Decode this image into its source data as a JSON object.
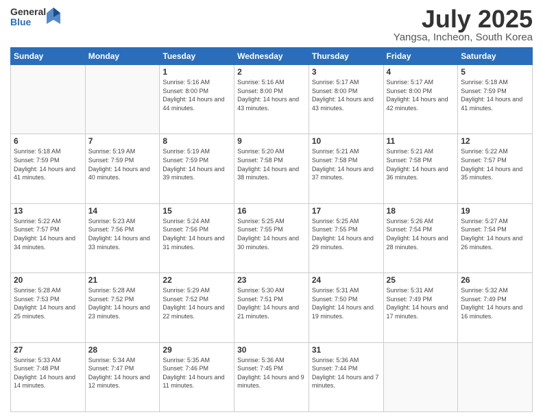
{
  "header": {
    "logo_general": "General",
    "logo_blue": "Blue",
    "title": "July 2025",
    "location": "Yangsa, Incheon, South Korea"
  },
  "calendar": {
    "weekdays": [
      "Sunday",
      "Monday",
      "Tuesday",
      "Wednesday",
      "Thursday",
      "Friday",
      "Saturday"
    ],
    "weeks": [
      [
        {
          "day": "",
          "sunrise": "",
          "sunset": "",
          "daylight": ""
        },
        {
          "day": "",
          "sunrise": "",
          "sunset": "",
          "daylight": ""
        },
        {
          "day": "1",
          "sunrise": "Sunrise: 5:16 AM",
          "sunset": "Sunset: 8:00 PM",
          "daylight": "Daylight: 14 hours and 44 minutes."
        },
        {
          "day": "2",
          "sunrise": "Sunrise: 5:16 AM",
          "sunset": "Sunset: 8:00 PM",
          "daylight": "Daylight: 14 hours and 43 minutes."
        },
        {
          "day": "3",
          "sunrise": "Sunrise: 5:17 AM",
          "sunset": "Sunset: 8:00 PM",
          "daylight": "Daylight: 14 hours and 43 minutes."
        },
        {
          "day": "4",
          "sunrise": "Sunrise: 5:17 AM",
          "sunset": "Sunset: 8:00 PM",
          "daylight": "Daylight: 14 hours and 42 minutes."
        },
        {
          "day": "5",
          "sunrise": "Sunrise: 5:18 AM",
          "sunset": "Sunset: 7:59 PM",
          "daylight": "Daylight: 14 hours and 41 minutes."
        }
      ],
      [
        {
          "day": "6",
          "sunrise": "Sunrise: 5:18 AM",
          "sunset": "Sunset: 7:59 PM",
          "daylight": "Daylight: 14 hours and 41 minutes."
        },
        {
          "day": "7",
          "sunrise": "Sunrise: 5:19 AM",
          "sunset": "Sunset: 7:59 PM",
          "daylight": "Daylight: 14 hours and 40 minutes."
        },
        {
          "day": "8",
          "sunrise": "Sunrise: 5:19 AM",
          "sunset": "Sunset: 7:59 PM",
          "daylight": "Daylight: 14 hours and 39 minutes."
        },
        {
          "day": "9",
          "sunrise": "Sunrise: 5:20 AM",
          "sunset": "Sunset: 7:58 PM",
          "daylight": "Daylight: 14 hours and 38 minutes."
        },
        {
          "day": "10",
          "sunrise": "Sunrise: 5:21 AM",
          "sunset": "Sunset: 7:58 PM",
          "daylight": "Daylight: 14 hours and 37 minutes."
        },
        {
          "day": "11",
          "sunrise": "Sunrise: 5:21 AM",
          "sunset": "Sunset: 7:58 PM",
          "daylight": "Daylight: 14 hours and 36 minutes."
        },
        {
          "day": "12",
          "sunrise": "Sunrise: 5:22 AM",
          "sunset": "Sunset: 7:57 PM",
          "daylight": "Daylight: 14 hours and 35 minutes."
        }
      ],
      [
        {
          "day": "13",
          "sunrise": "Sunrise: 5:22 AM",
          "sunset": "Sunset: 7:57 PM",
          "daylight": "Daylight: 14 hours and 34 minutes."
        },
        {
          "day": "14",
          "sunrise": "Sunrise: 5:23 AM",
          "sunset": "Sunset: 7:56 PM",
          "daylight": "Daylight: 14 hours and 33 minutes."
        },
        {
          "day": "15",
          "sunrise": "Sunrise: 5:24 AM",
          "sunset": "Sunset: 7:56 PM",
          "daylight": "Daylight: 14 hours and 31 minutes."
        },
        {
          "day": "16",
          "sunrise": "Sunrise: 5:25 AM",
          "sunset": "Sunset: 7:55 PM",
          "daylight": "Daylight: 14 hours and 30 minutes."
        },
        {
          "day": "17",
          "sunrise": "Sunrise: 5:25 AM",
          "sunset": "Sunset: 7:55 PM",
          "daylight": "Daylight: 14 hours and 29 minutes."
        },
        {
          "day": "18",
          "sunrise": "Sunrise: 5:26 AM",
          "sunset": "Sunset: 7:54 PM",
          "daylight": "Daylight: 14 hours and 28 minutes."
        },
        {
          "day": "19",
          "sunrise": "Sunrise: 5:27 AM",
          "sunset": "Sunset: 7:54 PM",
          "daylight": "Daylight: 14 hours and 26 minutes."
        }
      ],
      [
        {
          "day": "20",
          "sunrise": "Sunrise: 5:28 AM",
          "sunset": "Sunset: 7:53 PM",
          "daylight": "Daylight: 14 hours and 25 minutes."
        },
        {
          "day": "21",
          "sunrise": "Sunrise: 5:28 AM",
          "sunset": "Sunset: 7:52 PM",
          "daylight": "Daylight: 14 hours and 23 minutes."
        },
        {
          "day": "22",
          "sunrise": "Sunrise: 5:29 AM",
          "sunset": "Sunset: 7:52 PM",
          "daylight": "Daylight: 14 hours and 22 minutes."
        },
        {
          "day": "23",
          "sunrise": "Sunrise: 5:30 AM",
          "sunset": "Sunset: 7:51 PM",
          "daylight": "Daylight: 14 hours and 21 minutes."
        },
        {
          "day": "24",
          "sunrise": "Sunrise: 5:31 AM",
          "sunset": "Sunset: 7:50 PM",
          "daylight": "Daylight: 14 hours and 19 minutes."
        },
        {
          "day": "25",
          "sunrise": "Sunrise: 5:31 AM",
          "sunset": "Sunset: 7:49 PM",
          "daylight": "Daylight: 14 hours and 17 minutes."
        },
        {
          "day": "26",
          "sunrise": "Sunrise: 5:32 AM",
          "sunset": "Sunset: 7:49 PM",
          "daylight": "Daylight: 14 hours and 16 minutes."
        }
      ],
      [
        {
          "day": "27",
          "sunrise": "Sunrise: 5:33 AM",
          "sunset": "Sunset: 7:48 PM",
          "daylight": "Daylight: 14 hours and 14 minutes."
        },
        {
          "day": "28",
          "sunrise": "Sunrise: 5:34 AM",
          "sunset": "Sunset: 7:47 PM",
          "daylight": "Daylight: 14 hours and 12 minutes."
        },
        {
          "day": "29",
          "sunrise": "Sunrise: 5:35 AM",
          "sunset": "Sunset: 7:46 PM",
          "daylight": "Daylight: 14 hours and 11 minutes."
        },
        {
          "day": "30",
          "sunrise": "Sunrise: 5:36 AM",
          "sunset": "Sunset: 7:45 PM",
          "daylight": "Daylight: 14 hours and 9 minutes."
        },
        {
          "day": "31",
          "sunrise": "Sunrise: 5:36 AM",
          "sunset": "Sunset: 7:44 PM",
          "daylight": "Daylight: 14 hours and 7 minutes."
        },
        {
          "day": "",
          "sunrise": "",
          "sunset": "",
          "daylight": ""
        },
        {
          "day": "",
          "sunrise": "",
          "sunset": "",
          "daylight": ""
        }
      ]
    ]
  }
}
